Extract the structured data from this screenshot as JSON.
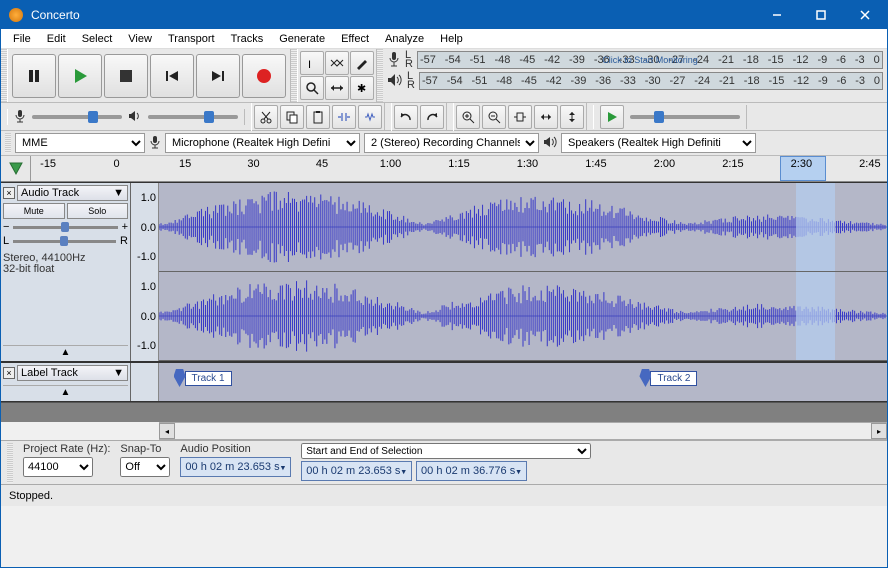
{
  "window": {
    "title": "Concerto"
  },
  "menu": [
    "File",
    "Edit",
    "Select",
    "View",
    "Transport",
    "Tracks",
    "Generate",
    "Effect",
    "Analyze",
    "Help"
  ],
  "meter": {
    "ticks": [
      "-57",
      "-54",
      "-51",
      "-48",
      "-45",
      "-42",
      "-39",
      "-36",
      "-33",
      "-30",
      "-27",
      "-24",
      "-21",
      "-18",
      "-15",
      "-12",
      "-9",
      "-6",
      "-3",
      "0"
    ],
    "click_text": "Click to Start Monitoring",
    "lr": [
      "L",
      "R"
    ]
  },
  "device": {
    "host": "MME",
    "input": "Microphone (Realtek High Defini",
    "channels": "2 (Stereo) Recording Channels",
    "output": "Speakers (Realtek High Definiti"
  },
  "ruler": {
    "labels": [
      "-15",
      "0",
      "15",
      "30",
      "45",
      "1:00",
      "1:15",
      "1:30",
      "1:45",
      "2:00",
      "2:15",
      "2:30",
      "2:45"
    ]
  },
  "track1": {
    "name": "Audio Track",
    "mute": "Mute",
    "solo": "Solo",
    "pan_l": "L",
    "pan_r": "R",
    "info1": "Stereo, 44100Hz",
    "info2": "32-bit float",
    "amp": [
      "1.0",
      "0.0",
      "-1.0"
    ]
  },
  "track2": {
    "name": "Label Track",
    "labels": [
      {
        "text": "Track 1",
        "left_pct": 2
      },
      {
        "text": "Track 2",
        "left_pct": 66
      }
    ]
  },
  "bottom": {
    "rate_label": "Project Rate (Hz):",
    "rate_value": "44100",
    "snap_label": "Snap-To",
    "snap_value": "Off",
    "pos_label": "Audio Position",
    "pos_value": "00 h 02 m 23.653 s",
    "sel_label": "Start and End of Selection",
    "sel_start": "00 h 02 m 23.653 s",
    "sel_end": "00 h 02 m 36.776 s"
  },
  "status": "Stopped."
}
